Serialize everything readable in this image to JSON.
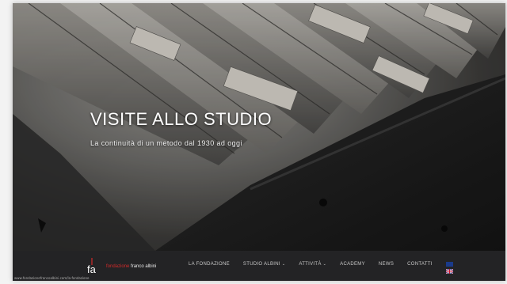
{
  "hero": {
    "title": "VISITE ALLO STUDIO",
    "subtitle": "La continuità di un metodo dal 1930 ad oggi",
    "image_description_icon": "archive-drawer-photo"
  },
  "logo": {
    "mark": "fa",
    "name_part1": "fondazione",
    "name_part2": "franco albini"
  },
  "nav": {
    "items": [
      {
        "label": "LA FONDAZIONE",
        "dropdown": false
      },
      {
        "label": "STUDIO ALBINI",
        "dropdown": true
      },
      {
        "label": "ATTIVITÀ",
        "dropdown": true
      },
      {
        "label": "ACADEMY",
        "dropdown": false
      },
      {
        "label": "NEWS",
        "dropdown": false
      },
      {
        "label": "CONTATTI",
        "dropdown": false
      }
    ],
    "language_flag": "uk-flag-icon"
  },
  "status_bar": {
    "url": "www.fondazionefrancoalbini.com/la-fondazione"
  },
  "colors": {
    "accent_red": "#d22a2a",
    "navbar_bg": "#232325"
  }
}
